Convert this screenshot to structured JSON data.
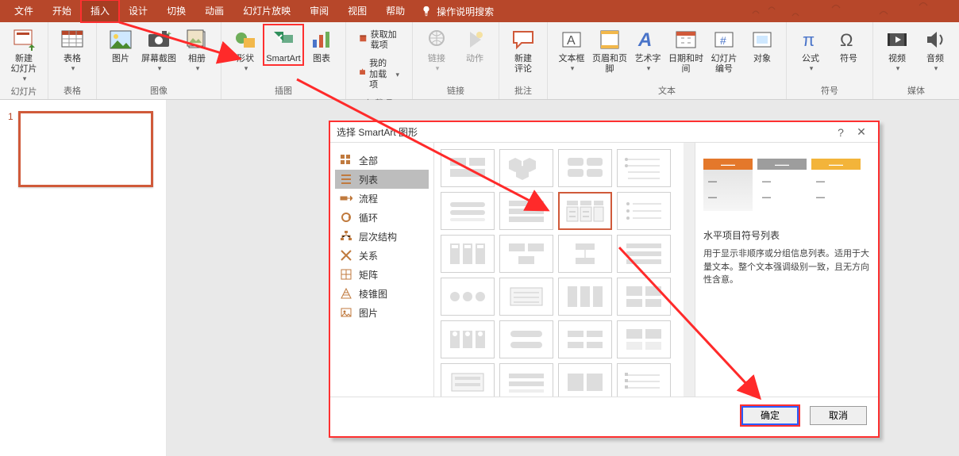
{
  "tabs": {
    "file": "文件",
    "home": "开始",
    "insert": "插入",
    "design": "设计",
    "transition": "切换",
    "animation": "动画",
    "slideshow": "幻灯片放映",
    "review": "审阅",
    "view": "视图",
    "help": "帮助",
    "tellme": "操作说明搜索"
  },
  "ribbon": {
    "slides_group": "幻灯片",
    "new_slide": "新建\n幻灯片",
    "tables_group": "表格",
    "table": "表格",
    "images_group": "图像",
    "pictures": "图片",
    "screenshot": "屏幕截图",
    "album": "相册",
    "illust_group": "插图",
    "shapes": "形状",
    "smartart": "SmartArt",
    "chart": "图表",
    "addins_group": "加载项",
    "get_addins": "获取加载项",
    "my_addins": "我的加载项",
    "links_group": "链接",
    "link": "链接",
    "action": "动作",
    "comments_group": "批注",
    "new_comment": "新建\n评论",
    "text_group": "文本",
    "textbox": "文本框",
    "header_footer": "页眉和页脚",
    "wordart": "艺术字",
    "datetime": "日期和时间",
    "slidenum": "幻灯片\n编号",
    "object": "对象",
    "symbols_group": "符号",
    "equation": "公式",
    "symbol": "符号",
    "media_group": "媒体",
    "video": "视频",
    "audio": "音频"
  },
  "thumb": {
    "num": "1"
  },
  "dialog": {
    "title": "选择 SmartArt 图形",
    "help": "?",
    "categories": {
      "all": "全部",
      "list": "列表",
      "process": "流程",
      "cycle": "循环",
      "hierarchy": "层次结构",
      "relationship": "关系",
      "matrix": "矩阵",
      "pyramid": "棱锥图",
      "picture": "图片"
    },
    "preview": {
      "name": "水平项目符号列表",
      "desc": "用于显示非顺序或分组信息列表。适用于大量文本。整个文本强调级别一致，且无方向性含意。"
    },
    "ok": "确定",
    "cancel": "取消"
  }
}
